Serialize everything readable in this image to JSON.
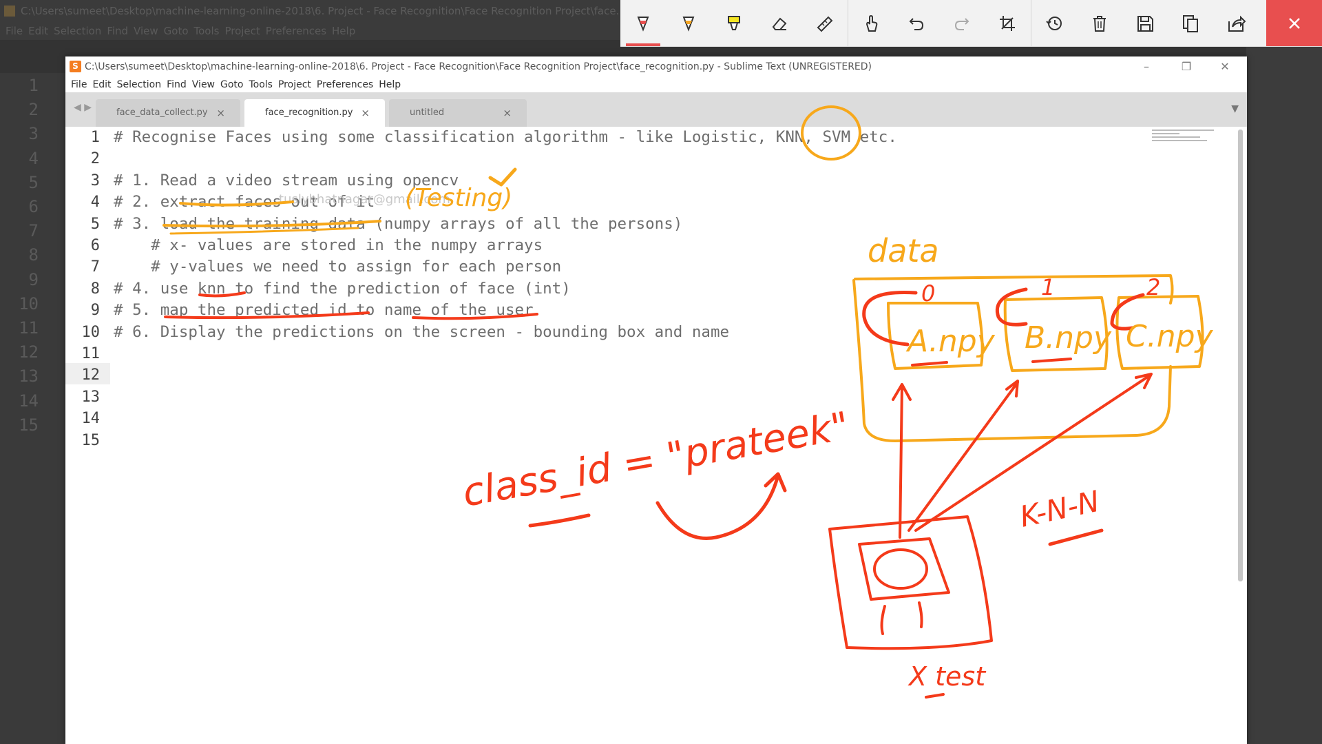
{
  "background_window": {
    "title": "C:\\Users\\sumeet\\Desktop\\machine-learning-online-2018\\6. Project - Face Recognition\\Face Recognition Project\\face...",
    "menu": [
      "File",
      "Edit",
      "Selection",
      "Find",
      "View",
      "Goto",
      "Tools",
      "Project",
      "Preferences",
      "Help"
    ],
    "line_numbers": [
      "1",
      "2",
      "3",
      "4",
      "5",
      "6",
      "7",
      "8",
      "9",
      "10",
      "11",
      "12",
      "13",
      "14",
      "15"
    ]
  },
  "annotation_toolbar": {
    "tools": [
      "red-pen-icon",
      "yellow-pen-icon",
      "highlighter-icon",
      "eraser-icon",
      "ruler-icon",
      "touch-write-icon",
      "undo-icon",
      "redo-icon",
      "crop-icon",
      "history-icon",
      "delete-icon",
      "save-icon",
      "copy-icon",
      "share-icon",
      "close-icon"
    ],
    "accent_color": "#e84f4f"
  },
  "editor_window": {
    "title": "C:\\Users\\sumeet\\Desktop\\machine-learning-online-2018\\6. Project - Face Recognition\\Face Recognition Project\\face_recognition.py - Sublime Text (UNREGISTERED)",
    "menu": [
      "File",
      "Edit",
      "Selection",
      "Find",
      "View",
      "Goto",
      "Tools",
      "Project",
      "Preferences",
      "Help"
    ],
    "tabs": [
      {
        "label": "face_data_collect.py",
        "active": false
      },
      {
        "label": "face_recognition.py",
        "active": true
      },
      {
        "label": "untitled",
        "active": false
      }
    ],
    "tab_close_glyph": "×",
    "watermark": "tuslybhatnagar@gmail.com",
    "line_numbers": [
      "1",
      "2",
      "3",
      "4",
      "5",
      "6",
      "7",
      "8",
      "9",
      "10",
      "11",
      "12",
      "13",
      "14",
      "15"
    ],
    "current_line": "12",
    "code_lines": [
      "# Recognise Faces using some classification algorithm - like Logistic, KNN, SVM etc.",
      "",
      "# 1. Read a video stream using opencv",
      "# 2. extract faces out of it",
      "# 3. load the training data (numpy arrays of all the persons)",
      "    # x- values are stored in the numpy arrays",
      "    # y-values we need to assign for each person",
      "# 4. use knn to find the prediction of face (int)",
      "# 5. map the predicted id to name of the user",
      "# 6. Display the predictions on the screen - bounding box and name",
      "",
      "",
      "",
      "",
      ""
    ]
  },
  "handwriting": {
    "testing": "(Testing)",
    "data": "data",
    "idx0": "0",
    "idx1": "1",
    "idx2": "2",
    "file_a": "A.npy",
    "file_b": "B.npy",
    "file_c": "C.npy",
    "class_id": "class_id = \"prateek\"",
    "knn": "K-N-N",
    "xtest": "X test",
    "check": "✓",
    "ink_red": "#f43a1a",
    "ink_orange": "#f7a81b"
  }
}
